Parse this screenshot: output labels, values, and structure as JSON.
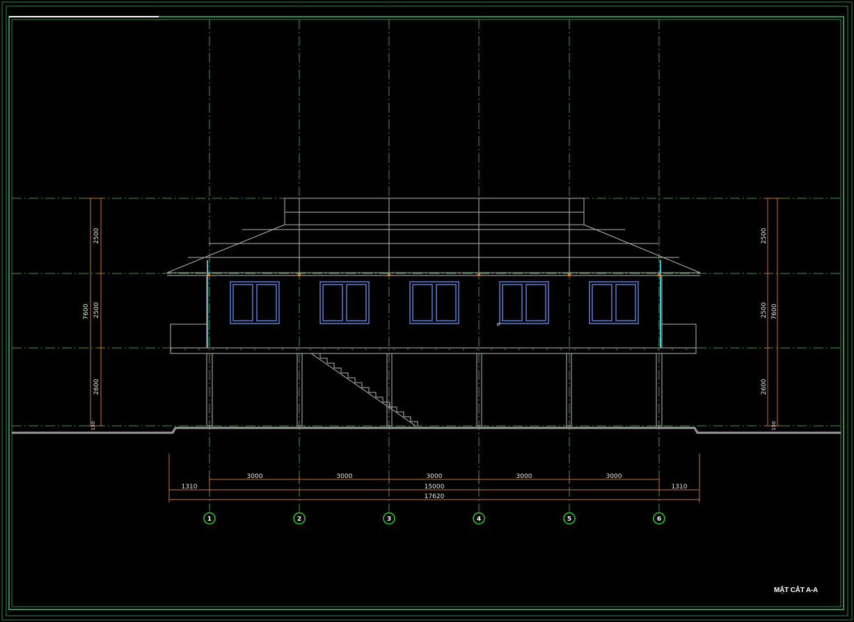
{
  "drawing": {
    "title": "MẶT CẮT A-A",
    "axes": [
      "1",
      "2",
      "3",
      "4",
      "5",
      "6"
    ],
    "bay_dimensions": [
      "3000",
      "3000",
      "3000",
      "3000",
      "3000"
    ],
    "overhang_left": "1310",
    "overhang_right": "1310",
    "span_total": "15000",
    "overall_total": "17620",
    "height_left": {
      "segments": [
        "2500",
        "2500",
        "2600",
        "150"
      ],
      "total": "7600"
    },
    "height_right": {
      "segments": [
        "2500",
        "2500",
        "2600",
        "150"
      ],
      "total": "7600"
    }
  },
  "colors": {
    "background": "#000000",
    "frame": "#2f8c55",
    "axis_line": "#3f9a3f",
    "dimension": "#c87833",
    "structure": "#c0c0c0",
    "window": "#5b7fd6",
    "glass_post": "#35c8d0",
    "axis_bubble": "#22d322"
  }
}
